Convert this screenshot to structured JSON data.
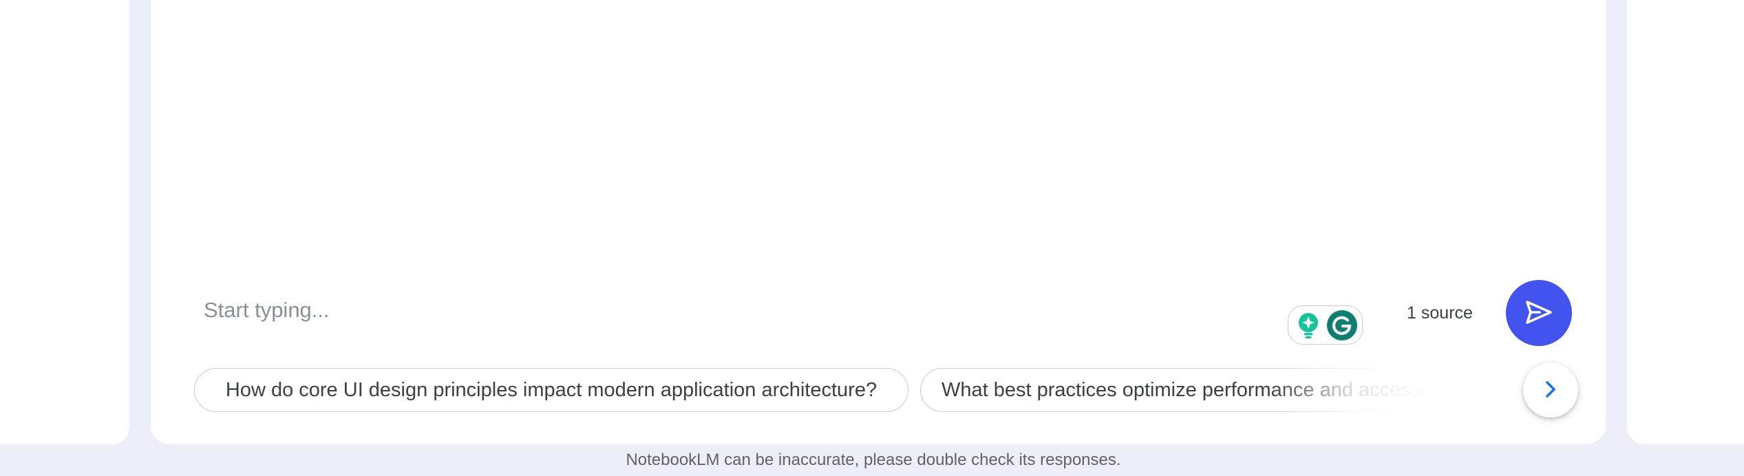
{
  "chat": {
    "input_placeholder": "Start typing...",
    "source_count": "1 source",
    "send_icon": "send-icon",
    "grammarly_icons": [
      "grammarly-lightbulb-icon",
      "grammarly-g-icon"
    ]
  },
  "suggestions": {
    "items": [
      "How do core UI design principles impact modern application architecture?",
      "What best practices optimize performance and accessibility in modern web applications?"
    ],
    "next_icon": "chevron-right-icon"
  },
  "footer": {
    "disclaimer": "NotebookLM can be inaccurate, please double check its responses."
  },
  "colors": {
    "background": "#eceef8",
    "panel": "#ffffff",
    "send_button": "#4353f0",
    "chevron": "#1a73e8",
    "grammarly": "#15c39a"
  }
}
